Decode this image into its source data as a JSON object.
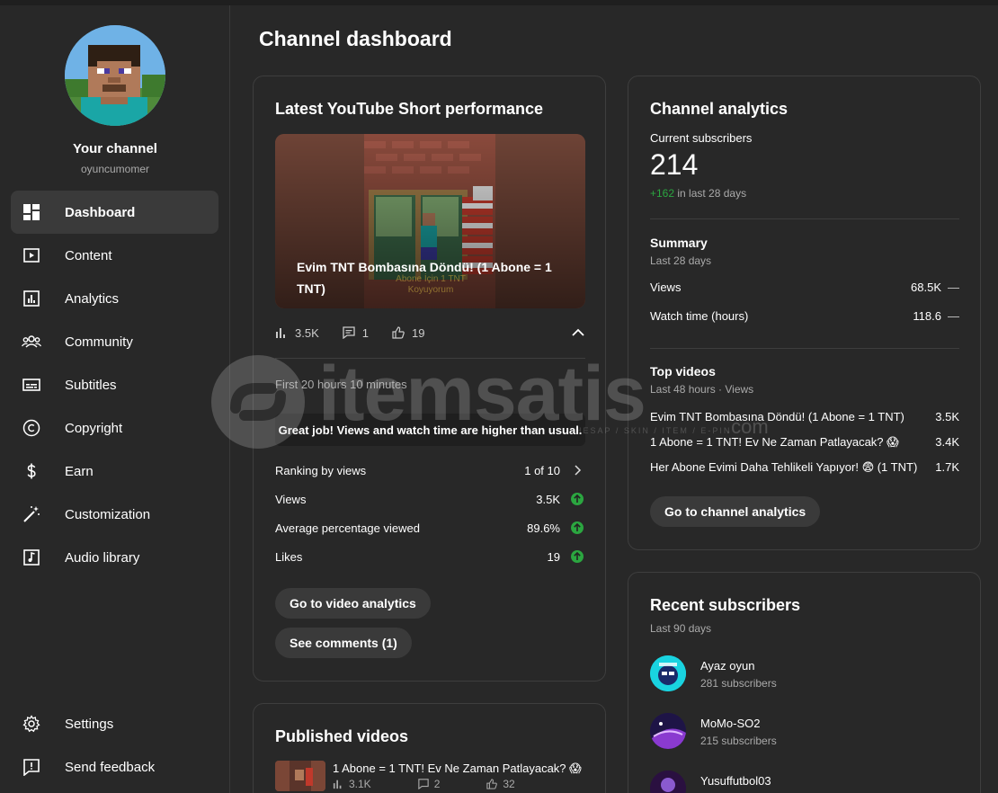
{
  "sidebar": {
    "channel_name": "Your channel",
    "channel_handle": "oyuncumomer",
    "items": [
      {
        "label": "Dashboard",
        "icon": "dashboard-icon",
        "active": true
      },
      {
        "label": "Content",
        "icon": "content-icon"
      },
      {
        "label": "Analytics",
        "icon": "analytics-icon"
      },
      {
        "label": "Community",
        "icon": "community-icon"
      },
      {
        "label": "Subtitles",
        "icon": "subtitles-icon"
      },
      {
        "label": "Copyright",
        "icon": "copyright-icon"
      },
      {
        "label": "Earn",
        "icon": "earn-icon"
      },
      {
        "label": "Customization",
        "icon": "customization-icon"
      },
      {
        "label": "Audio library",
        "icon": "audio-library-icon"
      }
    ],
    "bottom_items": [
      {
        "label": "Settings",
        "icon": "gear-icon"
      },
      {
        "label": "Send feedback",
        "icon": "feedback-icon"
      }
    ]
  },
  "page": {
    "title": "Channel dashboard"
  },
  "latest_short": {
    "title": "Latest YouTube Short performance",
    "video_title": "Evim TNT Bombasına Döndü! (1 Abone = 1 TNT)",
    "thumb_overlay_text": "Abone İçin 1 TNT Koyuyorum",
    "views": "3.5K",
    "comments": "1",
    "likes": "19",
    "period": "First 20 hours 10 minutes",
    "banner": "Great job! Views and watch time are higher than usual.",
    "metrics": [
      {
        "label": "Ranking by views",
        "value": "1 of 10"
      },
      {
        "label": "Views",
        "value": "3.5K"
      },
      {
        "label": "Average percentage viewed",
        "value": "89.6%"
      },
      {
        "label": "Likes",
        "value": "19"
      }
    ],
    "analytics_button": "Go to video analytics",
    "comments_button": "See comments (1)"
  },
  "channel_analytics": {
    "title": "Channel analytics",
    "subscribers_label": "Current subscribers",
    "subscribers_value": "214",
    "subscribers_change": "+162",
    "subscribers_change_period": "in last 28 days",
    "summary_title": "Summary",
    "summary_period": "Last 28 days",
    "summary": [
      {
        "label": "Views",
        "value": "68.5K",
        "trend": "—"
      },
      {
        "label": "Watch time (hours)",
        "value": "118.6",
        "trend": "—"
      }
    ],
    "top_videos_title": "Top videos",
    "top_videos_period": "Last 48 hours · Views",
    "top_videos": [
      {
        "title": "Evim TNT Bombasına Döndü! (1 Abone = 1 TNT)",
        "views": "3.5K"
      },
      {
        "title": "1 Abone = 1 TNT! Ev Ne Zaman Patlayacak? 😱",
        "views": "3.4K"
      },
      {
        "title": "Her Abone Evimi Daha Tehlikeli Yapıyor! 😨 (1 TNT)",
        "views": "1.7K"
      }
    ],
    "button": "Go to channel analytics"
  },
  "recent_subscribers": {
    "title": "Recent subscribers",
    "period": "Last 90 days",
    "items": [
      {
        "name": "Ayaz oyun",
        "count": "281 subscribers"
      },
      {
        "name": "MoMo-SO2",
        "count": "215 subscribers"
      },
      {
        "name": "Yusuffutbol03",
        "count": ""
      }
    ]
  },
  "published_videos": {
    "title": "Published videos",
    "items": [
      {
        "title": "1 Abone = 1 TNT! Ev Ne Zaman Patlayacak? 😱",
        "views": "3.1K",
        "comments": "2",
        "likes": "32"
      }
    ]
  },
  "watermark": {
    "brand": "itemsatis",
    "domain": ".com",
    "tagline": "HESAP / SKIN / ITEM / E-PIN"
  },
  "colors": {
    "background": "#282828",
    "card_border": "#3e3e3e",
    "positive": "#2ba640",
    "pill": "#3a3a3a"
  }
}
